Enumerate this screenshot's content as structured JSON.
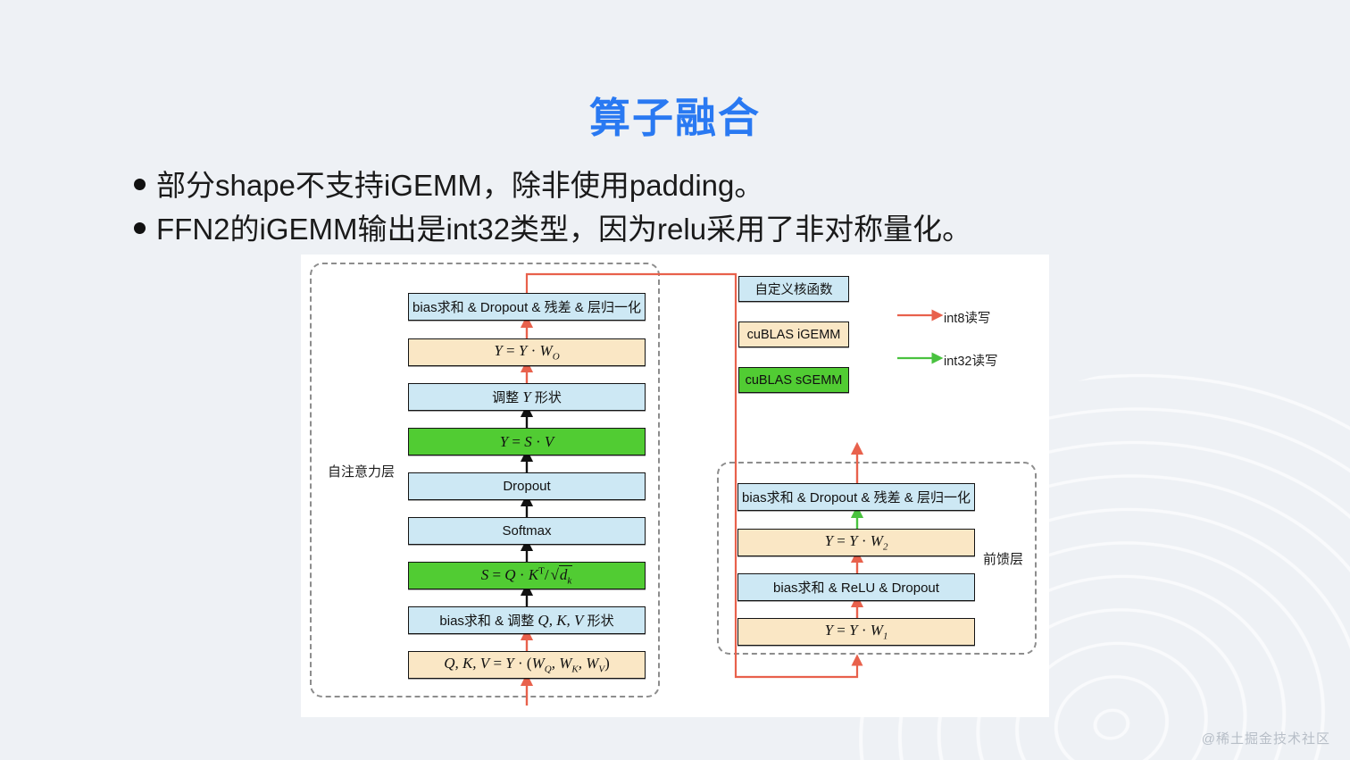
{
  "title": "算子融合",
  "bullets": [
    "部分shape不支持iGEMM，除非使用padding。",
    "FFN2的iGEMM输出是int32类型，因为relu采用了非对称量化。"
  ],
  "diagram": {
    "attention": {
      "label": "自注意力层",
      "boxes": [
        {
          "text": "bias求和 & Dropout & 残差 & 层归一化",
          "color": "blue",
          "kind": "text"
        },
        {
          "text": "Y = Y · W_O",
          "color": "orange",
          "kind": "math"
        },
        {
          "text": "调整 Y 形状",
          "color": "blue",
          "kind": "math"
        },
        {
          "text": "Y = S · V",
          "color": "green",
          "kind": "math"
        },
        {
          "text": "Dropout",
          "color": "blue",
          "kind": "text"
        },
        {
          "text": "Softmax",
          "color": "blue",
          "kind": "text"
        },
        {
          "text": "S = Q · K^T / √d_k",
          "color": "green",
          "kind": "math"
        },
        {
          "text": "bias求和 & 调整 Q, K, V 形状",
          "color": "blue",
          "kind": "math"
        },
        {
          "text": "Q, K, V = Y · (W_Q, W_K, W_V)",
          "color": "orange",
          "kind": "math"
        }
      ]
    },
    "feedforward": {
      "label": "前馈层",
      "boxes": [
        {
          "text": "bias求和 & Dropout & 残差 & 层归一化",
          "color": "blue",
          "kind": "text"
        },
        {
          "text": "Y = Y · W_2",
          "color": "orange",
          "kind": "math"
        },
        {
          "text": "bias求和 & ReLU & Dropout",
          "color": "blue",
          "kind": "text"
        },
        {
          "text": "Y = Y · W_1",
          "color": "orange",
          "kind": "math"
        }
      ]
    },
    "legend": {
      "chips": [
        {
          "text": "自定义核函数",
          "color": "blue"
        },
        {
          "text": "cuBLAS iGEMM",
          "color": "orange"
        },
        {
          "text": "cuBLAS sGEMM",
          "color": "green"
        }
      ],
      "arrows": [
        {
          "text": "int8读写",
          "color": "#e8614c"
        },
        {
          "text": "int32读写",
          "color": "#49c23f"
        }
      ]
    }
  },
  "colors": {
    "title": "#2979f2",
    "blue_box": "#cde8f4",
    "orange_box": "#fae7c5",
    "green_box": "#51cc33",
    "int8_arrow": "#e8614c",
    "int32_arrow": "#49c23f",
    "background": "#eef1f5"
  },
  "watermark": "@稀土掘金技术社区"
}
